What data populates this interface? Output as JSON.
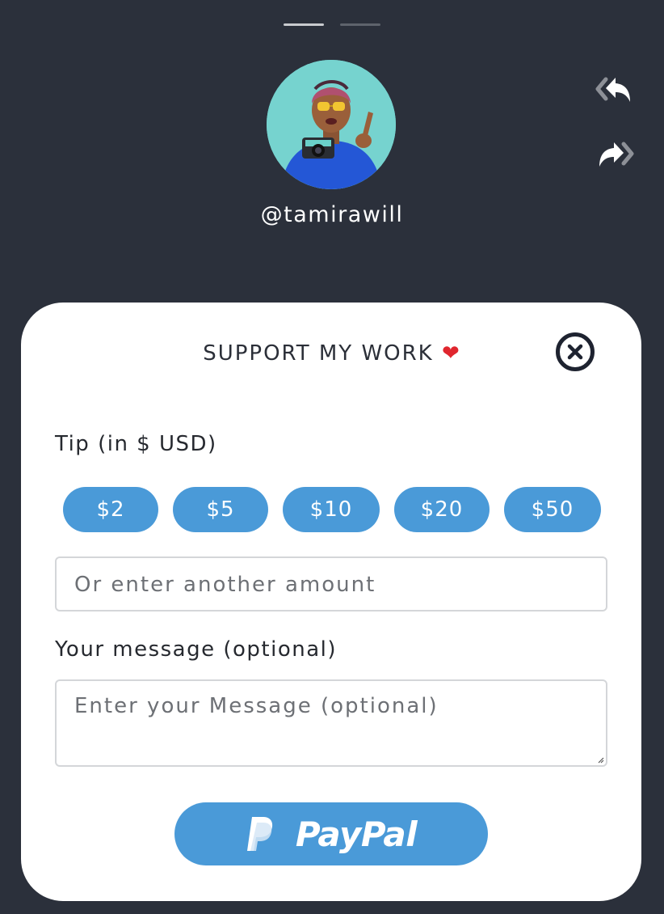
{
  "story": {
    "segments": 2,
    "active_segment": 1
  },
  "profile": {
    "handle": "@tamirawill"
  },
  "actions": {
    "reply_icon": "reply-icon",
    "forward_icon": "forward-icon"
  },
  "modal": {
    "title": "SUPPORT MY WORK",
    "title_emoji": "❤",
    "close_icon": "close-icon",
    "tip_label": "Tip (in $ USD)",
    "tip_options": [
      "$2",
      "$5",
      "$10",
      "$20",
      "$50"
    ],
    "amount_placeholder": "Or enter another amount",
    "message_label": "Your message (optional)",
    "message_placeholder": "Enter your Message (optional)",
    "paypal_label": "PayPal"
  },
  "colors": {
    "background": "#2b303b",
    "card": "#ffffff",
    "accent": "#4a9ad8",
    "heart": "#e0262e"
  }
}
